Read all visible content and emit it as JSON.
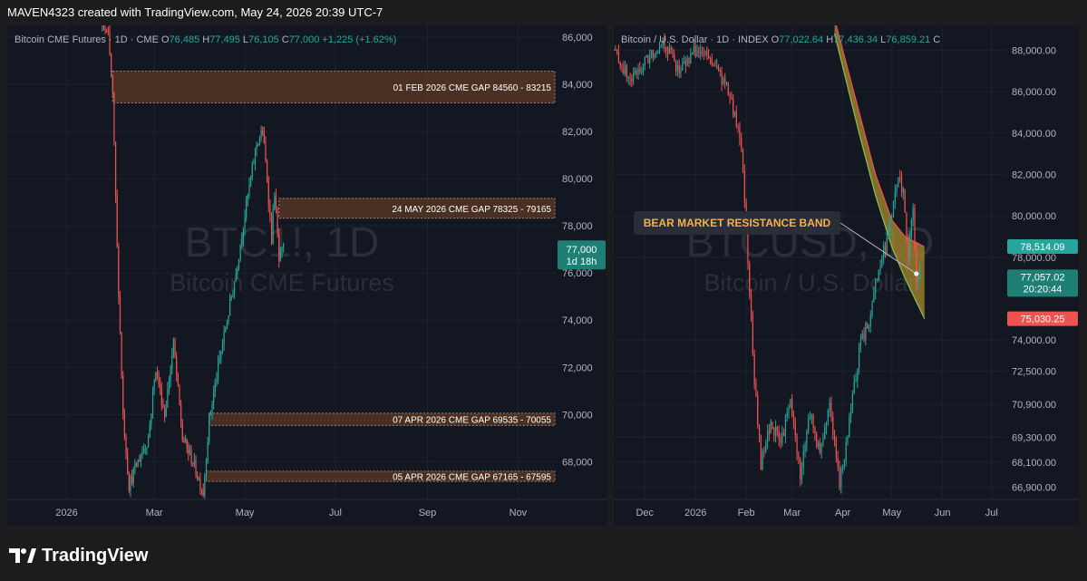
{
  "top_caption": "MAVEN4323 created with TradingView.com, May 24, 2026 20:39 UTC-7",
  "footer": {
    "brand": "TradingView",
    "icon": "tradingview-logo"
  },
  "colors": {
    "up": "#26a69a",
    "down": "#ef5350",
    "gap": "#5d3a23",
    "band": "#b8a13a",
    "label_bg": "#2a2e39"
  },
  "chart_data": [
    {
      "type": "candlestick",
      "header": {
        "symbol": "Bitcoin CME Futures · 1D · CME",
        "o_label": "O",
        "o": "76,485",
        "h_label": "H",
        "h": "77,495",
        "l_label": "L",
        "l": "76,105",
        "c_label": "C",
        "c": "77,000",
        "change": "+1,225 (+1.62%)"
      },
      "watermark": {
        "ticker": "BTC1!, 1D",
        "name": "Bitcoin CME Futures"
      },
      "y_ticks": [
        "86,000",
        "84,000",
        "82,000",
        "80,000",
        "78,000",
        "76,000",
        "74,000",
        "72,000",
        "70,000",
        "68,000"
      ],
      "y_tick_values": [
        86000,
        84000,
        82000,
        80000,
        78000,
        76000,
        74000,
        72000,
        70000,
        68000
      ],
      "ylim": [
        66400,
        86500
      ],
      "x_ticks": [
        "2026",
        "Mar",
        "May",
        "Jul",
        "Sep",
        "Nov"
      ],
      "x_tick_days": [
        0,
        59,
        120,
        181,
        243,
        304
      ],
      "xlim": [
        -40,
        330
      ],
      "last_price": {
        "value": 77000,
        "label": "77,000",
        "countdown": "1d 18h"
      },
      "gaps": [
        {
          "label": "01 FEB 2026 CME GAP 84560 - 83215",
          "low": 83215,
          "high": 84560,
          "start_day": 31
        },
        {
          "label": "24 MAY 2026 CME GAP 78325 - 79165",
          "low": 78325,
          "high": 79165,
          "start_day": 143
        },
        {
          "label": "07 APR 2026 CME GAP 69535 - 70055",
          "low": 69535,
          "high": 70055,
          "start_day": 96
        },
        {
          "label": "05 APR 2026 CME GAP 67165 - 67595",
          "low": 67165,
          "high": 67595,
          "start_day": 94
        }
      ],
      "price_path": [
        [
          -40,
          88500
        ],
        [
          -30,
          88000
        ],
        [
          -20,
          87500
        ],
        [
          -10,
          88500
        ],
        [
          0,
          89000
        ],
        [
          10,
          88000
        ],
        [
          20,
          87000
        ],
        [
          28,
          86000
        ],
        [
          31,
          83500
        ],
        [
          34,
          77000
        ],
        [
          38,
          70000
        ],
        [
          42,
          67000
        ],
        [
          48,
          68000
        ],
        [
          55,
          69000
        ],
        [
          60,
          72000
        ],
        [
          66,
          70000
        ],
        [
          72,
          73000
        ],
        [
          78,
          69000
        ],
        [
          85,
          68000
        ],
        [
          92,
          66700
        ],
        [
          96,
          69800
        ],
        [
          102,
          72000
        ],
        [
          108,
          74000
        ],
        [
          114,
          76000
        ],
        [
          120,
          78500
        ],
        [
          128,
          81500
        ],
        [
          132,
          82000
        ],
        [
          135,
          80000
        ],
        [
          138,
          77500
        ],
        [
          140,
          79500
        ],
        [
          143,
          76500
        ],
        [
          146,
          77000
        ]
      ]
    },
    {
      "type": "candlestick",
      "header": {
        "symbol": "Bitcoin / U.S. Dollar · 1D · INDEX",
        "o_label": "O",
        "o": "77,022.64",
        "h_label": "H",
        "h": "77,436.34",
        "l_label": "L",
        "l": "76,859.21",
        "c_label": "C",
        "c": ""
      },
      "watermark": {
        "ticker": "BTCUSD, 1D",
        "name": "Bitcoin / U.S. Dollar"
      },
      "y_ticks": [
        "88,000.00",
        "86,000.00",
        "84,000.00",
        "82,000.00",
        "80,000.00",
        "78,000.00",
        "74,000.00",
        "72,500.00",
        "70,900.00",
        "69,300.00",
        "68,100.00",
        "66,900.00"
      ],
      "y_tick_values": [
        88000,
        86000,
        84000,
        82000,
        80000,
        78000,
        74000,
        72500,
        70900,
        69300,
        68100,
        66900
      ],
      "ylim": [
        66300,
        89200
      ],
      "x_ticks": [
        "Dec",
        "2026",
        "Feb",
        "Mar",
        "Apr",
        "May",
        "Jun",
        "Jul"
      ],
      "x_tick_days": [
        -31,
        0,
        31,
        59,
        90,
        120,
        151,
        181
      ],
      "xlim": [
        -50,
        190
      ],
      "price_labels": [
        {
          "label": "78,514.09",
          "value": 78514.09,
          "color": "#26a69a"
        },
        {
          "label": "77,057.02",
          "value": 77057.02,
          "countdown": "20:20:44",
          "color": "#1e7f74"
        },
        {
          "label": "75,030.25",
          "value": 75030.25,
          "color": "#ef5350"
        }
      ],
      "annotation": {
        "text": "BEAR MARKET RESISTANCE BAND",
        "point_day": 135,
        "point_value": 77200
      },
      "band_upper": [
        [
          85,
          89500
        ],
        [
          100,
          85000
        ],
        [
          110,
          82000
        ],
        [
          120,
          79800
        ],
        [
          128,
          79000
        ],
        [
          140,
          78500
        ]
      ],
      "band_lower": [
        [
          85,
          88800
        ],
        [
          100,
          84000
        ],
        [
          110,
          81000
        ],
        [
          120,
          78500
        ],
        [
          128,
          77000
        ],
        [
          140,
          75030
        ]
      ],
      "price_path": [
        [
          -50,
          88000
        ],
        [
          -40,
          86500
        ],
        [
          -30,
          87500
        ],
        [
          -20,
          88500
        ],
        [
          -10,
          87000
        ],
        [
          0,
          88000
        ],
        [
          10,
          87500
        ],
        [
          20,
          86000
        ],
        [
          28,
          83500
        ],
        [
          32,
          78000
        ],
        [
          36,
          72000
        ],
        [
          40,
          68000
        ],
        [
          46,
          70000
        ],
        [
          52,
          69000
        ],
        [
          58,
          71000
        ],
        [
          64,
          67500
        ],
        [
          70,
          70500
        ],
        [
          76,
          68500
        ],
        [
          82,
          71000
        ],
        [
          88,
          67000
        ],
        [
          94,
          70000
        ],
        [
          100,
          73500
        ],
        [
          106,
          75000
        ],
        [
          112,
          77500
        ],
        [
          118,
          79000
        ],
        [
          124,
          82000
        ],
        [
          127,
          81000
        ],
        [
          130,
          78000
        ],
        [
          133,
          80500
        ],
        [
          135,
          76500
        ],
        [
          137,
          77057
        ]
      ]
    }
  ]
}
